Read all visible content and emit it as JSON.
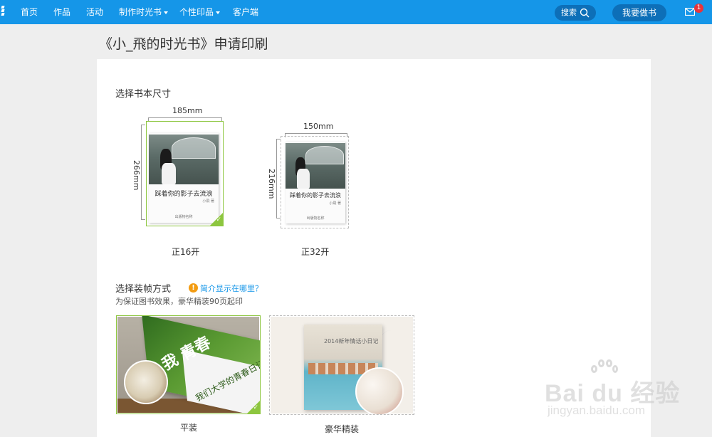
{
  "nav": {
    "items": [
      {
        "label": "首页"
      },
      {
        "label": "作品"
      },
      {
        "label": "活动"
      },
      {
        "label": "制作时光书"
      },
      {
        "label": "个性印品"
      },
      {
        "label": "客户端"
      }
    ],
    "search_label": "搜索",
    "make_book_label": "我要做书",
    "mail_badge": "1"
  },
  "page": {
    "title": "《小_飛的时光书》申请印刷"
  },
  "size_section": {
    "title": "选择书本尺寸",
    "options": [
      {
        "width": "185mm",
        "height": "266mm",
        "label": "正16开",
        "selected": true,
        "cover_title": "踩着你的影子去流浪",
        "cover_author": "小飛 著",
        "cover_publisher": "出版物名称"
      },
      {
        "width": "150mm",
        "height": "216mm",
        "label": "正32开",
        "selected": false,
        "cover_title": "踩着你的影子去流浪",
        "cover_author": "小飛 著",
        "cover_publisher": "出版物名称"
      }
    ]
  },
  "binding_section": {
    "title": "选择装帧方式",
    "info_link": "简介显示在哪里？",
    "note": "为保证图书效果，豪华精装90页起印",
    "options": [
      {
        "label": "平装",
        "selected": true,
        "cover_title": "我 青春",
        "cover_sub": "我们大学的青春日记"
      },
      {
        "label": "豪华精装",
        "selected": false,
        "cover_title": "2014新年情话小日记"
      }
    ]
  },
  "watermark": {
    "brand": "Bai du 经验",
    "url": "jingyan.baidu.com"
  },
  "colors": {
    "nav_bg": "#1596e8",
    "button_bg": "#0d6fb8",
    "selected_border": "#8dc63f",
    "link": "#1596e8",
    "badge": "#e8343b",
    "info_icon": "#f39c12"
  }
}
